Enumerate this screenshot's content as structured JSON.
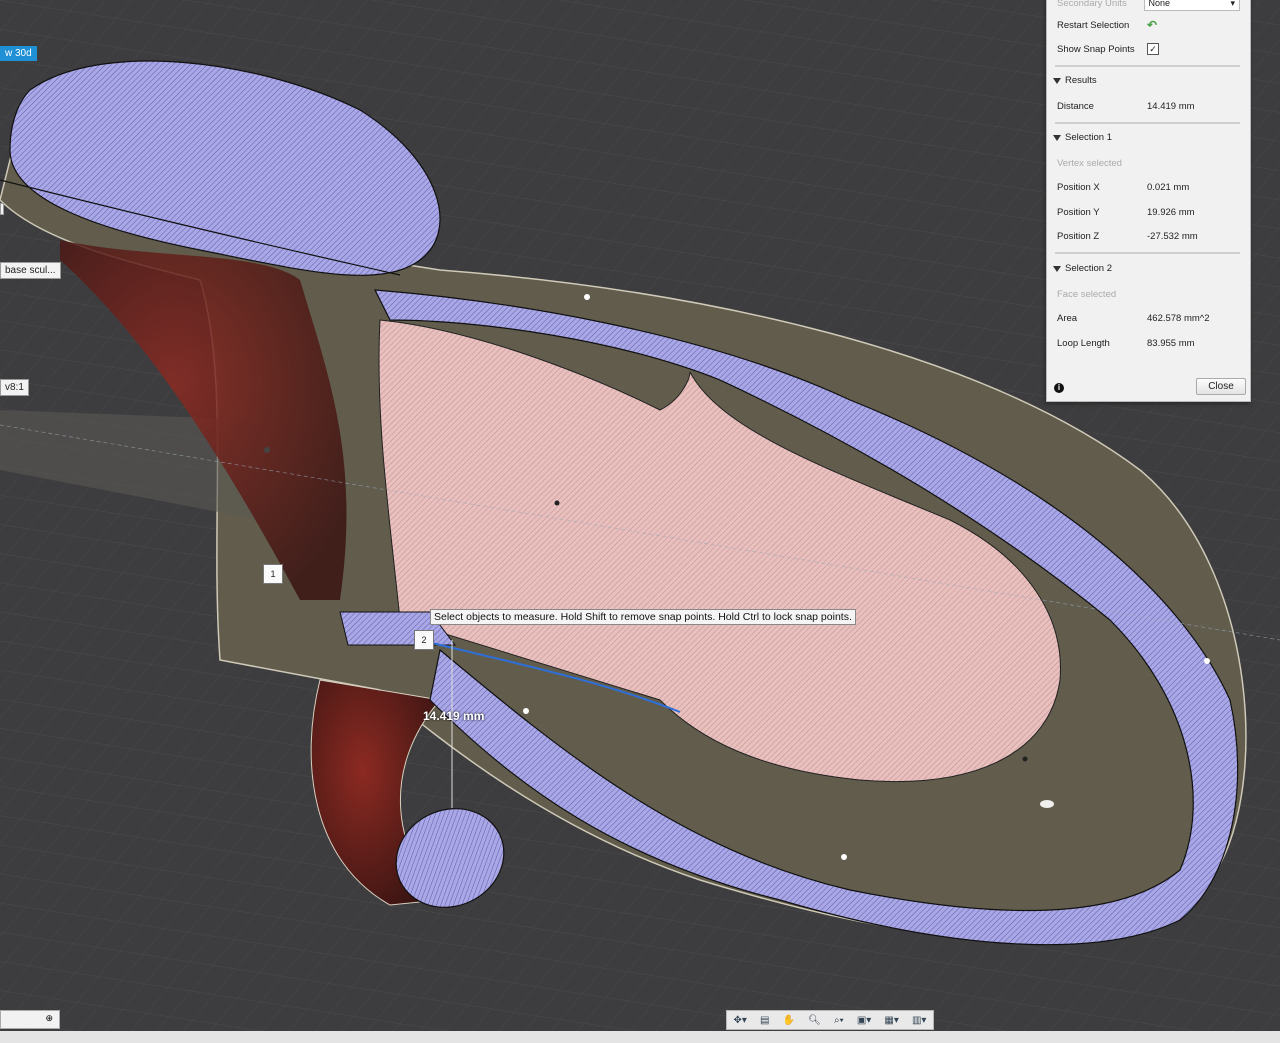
{
  "browser_tags": {
    "view": "w 30d",
    "body": "base scul...",
    "version": "v8:1"
  },
  "markers": {
    "one": "1",
    "two": "2"
  },
  "tooltip": "Select objects to measure. Hold Shift to remove snap points. Hold Ctrl to lock snap points.",
  "dimension_label": "14.419 mm",
  "panel": {
    "secondary_units_label": "Secondary Units",
    "secondary_units_value": "None",
    "restart_selection_label": "Restart Selection",
    "show_snap_points_label": "Show Snap Points",
    "show_snap_points_checked": "✓",
    "results": {
      "header": "Results",
      "distance_label": "Distance",
      "distance_value": "14.419 mm"
    },
    "selection1": {
      "header": "Selection 1",
      "status": "Vertex selected",
      "pos_x_label": "Position X",
      "pos_x_value": "0.021 mm",
      "pos_y_label": "Position Y",
      "pos_y_value": "19.926 mm",
      "pos_z_label": "Position Z",
      "pos_z_value": "-27.532 mm"
    },
    "selection2": {
      "header": "Selection 2",
      "status": "Face selected",
      "area_label": "Area",
      "area_value": "462.578 mm^2",
      "loop_label": "Loop Length",
      "loop_value": "83.955 mm"
    },
    "close_label": "Close"
  },
  "colors": {
    "background": "#3d3d3f",
    "section_fill": "#a7a5e3",
    "face_fill": "#e6b8b8",
    "body_fill": "#6b6450",
    "dark_red": "#6a1e1a"
  }
}
